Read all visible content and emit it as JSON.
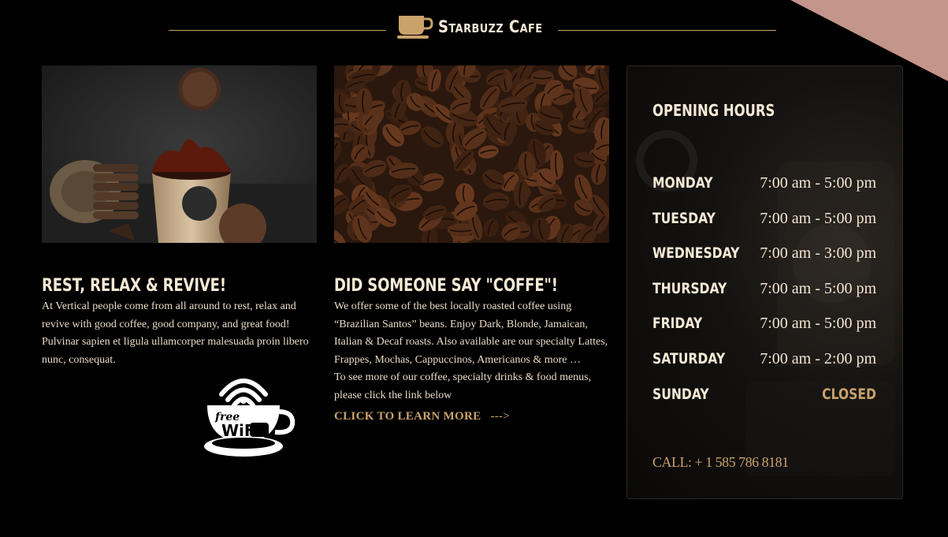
{
  "header": {
    "brand": "Starbuzz Cafe"
  },
  "col1": {
    "title": "REST, RELAX & REVIVE!",
    "text": "At Vertical people come from all around to rest, relax and revive with good coffee, good company, and great food! Pulvinar sapien et ligula ullamcorper malesuada proin libero nunc, consequat.",
    "wifi_free": "free",
    "wifi_label": "WiFi"
  },
  "col2": {
    "title": "DID SOMEONE SAY \"COFFE\"!",
    "text": "We offer some of the best locally roasted coffee using “Brazilian Santos” beans. Enjoy Dark, Blonde, Jamaican, Italian & Decaf roasts. Also available are our specialty Lattes, Frappes, Mochas, Cappuccinos, Americanos & more …",
    "text2": "To see more of our coffee, specialty drinks & food menus, please click the link below",
    "learn_more": "CLICK TO LEARN MORE",
    "learn_arrow": "--->"
  },
  "hours": {
    "title": "OPENING HOURS",
    "days": [
      {
        "day": "MONDAY",
        "time": "7:00 am - 5:00 pm"
      },
      {
        "day": "TUESDAY",
        "time": "7:00 am - 5:00 pm"
      },
      {
        "day": "WEDNESDAY",
        "time": "7:00 am - 3:00 pm"
      },
      {
        "day": "THURSDAY",
        "time": "7:00 am - 5:00 pm"
      },
      {
        "day": "FRIDAY",
        "time": "7:00 am - 5:00 pm"
      },
      {
        "day": "SATURDAY",
        "time": "7:00 am - 2:00 pm"
      },
      {
        "day": "SUNDAY",
        "time": "CLOSED"
      }
    ],
    "call": "CALL: + 1 585 786 8181"
  },
  "colors": {
    "accent": "#c9a26b",
    "cream": "#f7ead6",
    "background": "#000000",
    "corner": "#c4958a"
  }
}
